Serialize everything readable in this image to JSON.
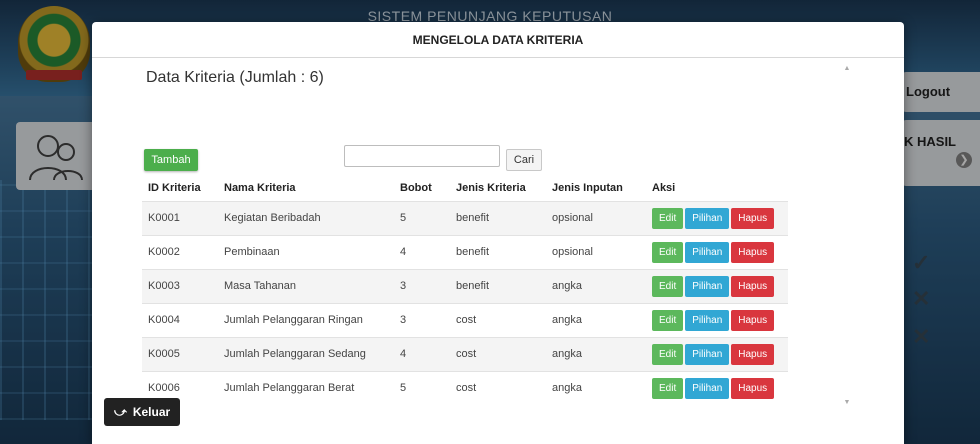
{
  "background": {
    "app_title": "SISTEM PENUNJANG KEPUTUSAN",
    "logout_label": "Logout",
    "hasil_label": "K HASIL",
    "arrow_icon": "chevron-right-circle-icon",
    "marks": [
      "✓",
      "✕",
      "✕"
    ]
  },
  "modal": {
    "title": "MENGELOLA DATA KRITERIA",
    "heading": "Data Kriteria (Jumlah : 6)",
    "add_label": "Tambah",
    "search": {
      "value": "",
      "placeholder": ""
    },
    "search_label": "Cari",
    "columns": [
      "ID Kriteria",
      "Nama Kriteria",
      "Bobot",
      "Jenis Kriteria",
      "Jenis Inputan",
      "Aksi"
    ],
    "rows": [
      {
        "id": "K0001",
        "nama": "Kegiatan Beribadah",
        "bobot": "5",
        "jenis_kriteria": "benefit",
        "jenis_inputan": "opsional"
      },
      {
        "id": "K0002",
        "nama": "Pembinaan",
        "bobot": "4",
        "jenis_kriteria": "benefit",
        "jenis_inputan": "opsional"
      },
      {
        "id": "K0003",
        "nama": "Masa Tahanan",
        "bobot": "3",
        "jenis_kriteria": "benefit",
        "jenis_inputan": "angka"
      },
      {
        "id": "K0004",
        "nama": "Jumlah Pelanggaran Ringan",
        "bobot": "3",
        "jenis_kriteria": "cost",
        "jenis_inputan": "angka"
      },
      {
        "id": "K0005",
        "nama": "Jumlah Pelanggaran Sedang",
        "bobot": "4",
        "jenis_kriteria": "cost",
        "jenis_inputan": "angka"
      },
      {
        "id": "K0006",
        "nama": "Jumlah Pelanggaran Berat",
        "bobot": "5",
        "jenis_kriteria": "cost",
        "jenis_inputan": "angka"
      }
    ],
    "actions": {
      "edit": "Edit",
      "pilihan": "Pilihan",
      "hapus": "Hapus"
    },
    "back_label": "Keluar",
    "back_icon": "undo-arrow-icon"
  },
  "colors": {
    "success": "#5cb85c",
    "info": "#31a7d4",
    "danger": "#d9363e",
    "dark": "#222222"
  }
}
